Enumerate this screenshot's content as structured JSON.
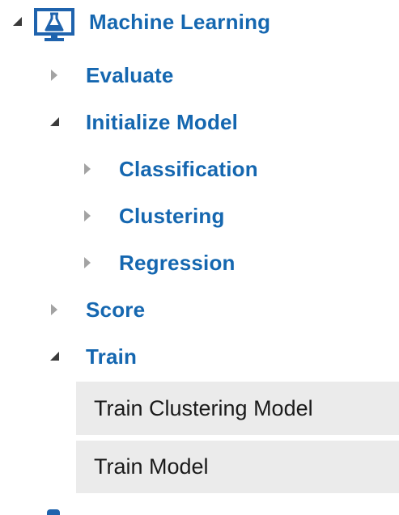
{
  "tree": {
    "root": {
      "label": "Machine Learning",
      "icon": "flask-monitor-icon",
      "expanded": true
    },
    "items": [
      {
        "label": "Evaluate",
        "expanded": false
      },
      {
        "label": "Initialize Model",
        "expanded": true,
        "children": [
          {
            "label": "Classification",
            "expanded": false
          },
          {
            "label": "Clustering",
            "expanded": false
          },
          {
            "label": "Regression",
            "expanded": false
          }
        ]
      },
      {
        "label": "Score",
        "expanded": false
      },
      {
        "label": "Train",
        "expanded": true,
        "modules": [
          {
            "label": "Train Clustering Model"
          },
          {
            "label": "Train Model"
          }
        ]
      }
    ]
  },
  "colors": {
    "category_text": "#1567b0",
    "icon_blue": "#1f63ad",
    "toggle_gray": "#a3a3a3",
    "toggle_dark": "#3b3b3b",
    "module_bg": "#ebebeb",
    "module_text": "#1a1a1a"
  }
}
